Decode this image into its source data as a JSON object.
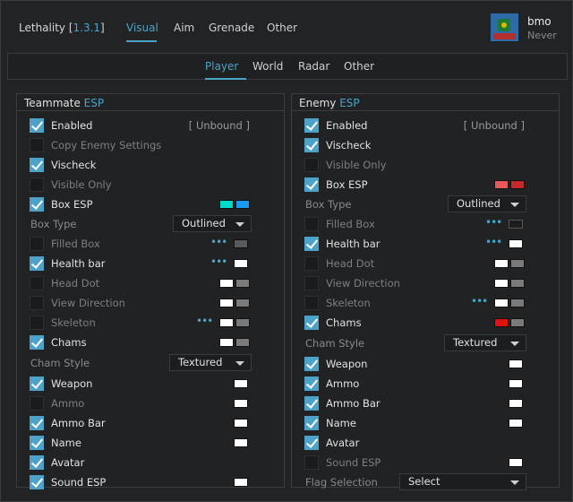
{
  "app": {
    "name": "Lethality ",
    "version": "1.3.1"
  },
  "main_tabs": [
    "Visual",
    "Aim",
    "Grenade",
    "Other"
  ],
  "user": {
    "name": "bmo",
    "status": "Never"
  },
  "sub_tabs": [
    "Player",
    "World",
    "Radar",
    "Other"
  ],
  "colors": {
    "accent": "#4aa3c8",
    "checkbox_on": "#4ea2c8"
  },
  "teammate": {
    "title": "Teammate ",
    "title_accent": "ESP",
    "bind_label": "[ Unbound ]",
    "rows": [
      {
        "label": "Enabled",
        "checked": true
      },
      {
        "label": "Copy Enemy Settings",
        "checked": false
      },
      {
        "label": "Vischeck",
        "checked": true
      },
      {
        "label": "Visible Only",
        "checked": false
      },
      {
        "label": "Box ESP",
        "checked": true
      },
      {
        "label": "Box Type",
        "section": true
      },
      {
        "label": "Filled Box",
        "checked": false
      },
      {
        "label": "Health bar",
        "checked": true
      },
      {
        "label": "Head Dot",
        "checked": false
      },
      {
        "label": "View Direction",
        "checked": false
      },
      {
        "label": "Skeleton",
        "checked": false
      },
      {
        "label": "Chams",
        "checked": true
      },
      {
        "label": "Cham Style",
        "section": true
      },
      {
        "label": "Weapon",
        "checked": true
      },
      {
        "label": "Ammo",
        "checked": false
      },
      {
        "label": "Ammo Bar",
        "checked": true
      },
      {
        "label": "Name",
        "checked": true
      },
      {
        "label": "Avatar",
        "checked": true
      },
      {
        "label": "Sound ESP",
        "checked": true
      }
    ],
    "box_type": "Outlined",
    "cham_style": "Textured"
  },
  "enemy": {
    "title": "Enemy ",
    "title_accent": "ESP",
    "bind_label": "[ Unbound ]",
    "rows": [
      {
        "label": "Enabled",
        "checked": true
      },
      {
        "label": "Vischeck",
        "checked": true
      },
      {
        "label": "Visible Only",
        "checked": false
      },
      {
        "label": "Box ESP",
        "checked": true
      },
      {
        "label": "Box Type",
        "section": true
      },
      {
        "label": "Filled Box",
        "checked": false
      },
      {
        "label": "Health bar",
        "checked": true
      },
      {
        "label": "Head Dot",
        "checked": false
      },
      {
        "label": "View Direction",
        "checked": false
      },
      {
        "label": "Skeleton",
        "checked": false
      },
      {
        "label": "Chams",
        "checked": true
      },
      {
        "label": "Cham Style",
        "section": true
      },
      {
        "label": "Weapon",
        "checked": true
      },
      {
        "label": "Ammo",
        "checked": true
      },
      {
        "label": "Ammo Bar",
        "checked": true
      },
      {
        "label": "Name",
        "checked": true
      },
      {
        "label": "Avatar",
        "checked": true
      },
      {
        "label": "Sound ESP",
        "checked": false
      },
      {
        "label": "Flag Selection",
        "section": true
      }
    ],
    "box_type": "Outlined",
    "cham_style": "Textured",
    "flag_selection": "Select"
  }
}
